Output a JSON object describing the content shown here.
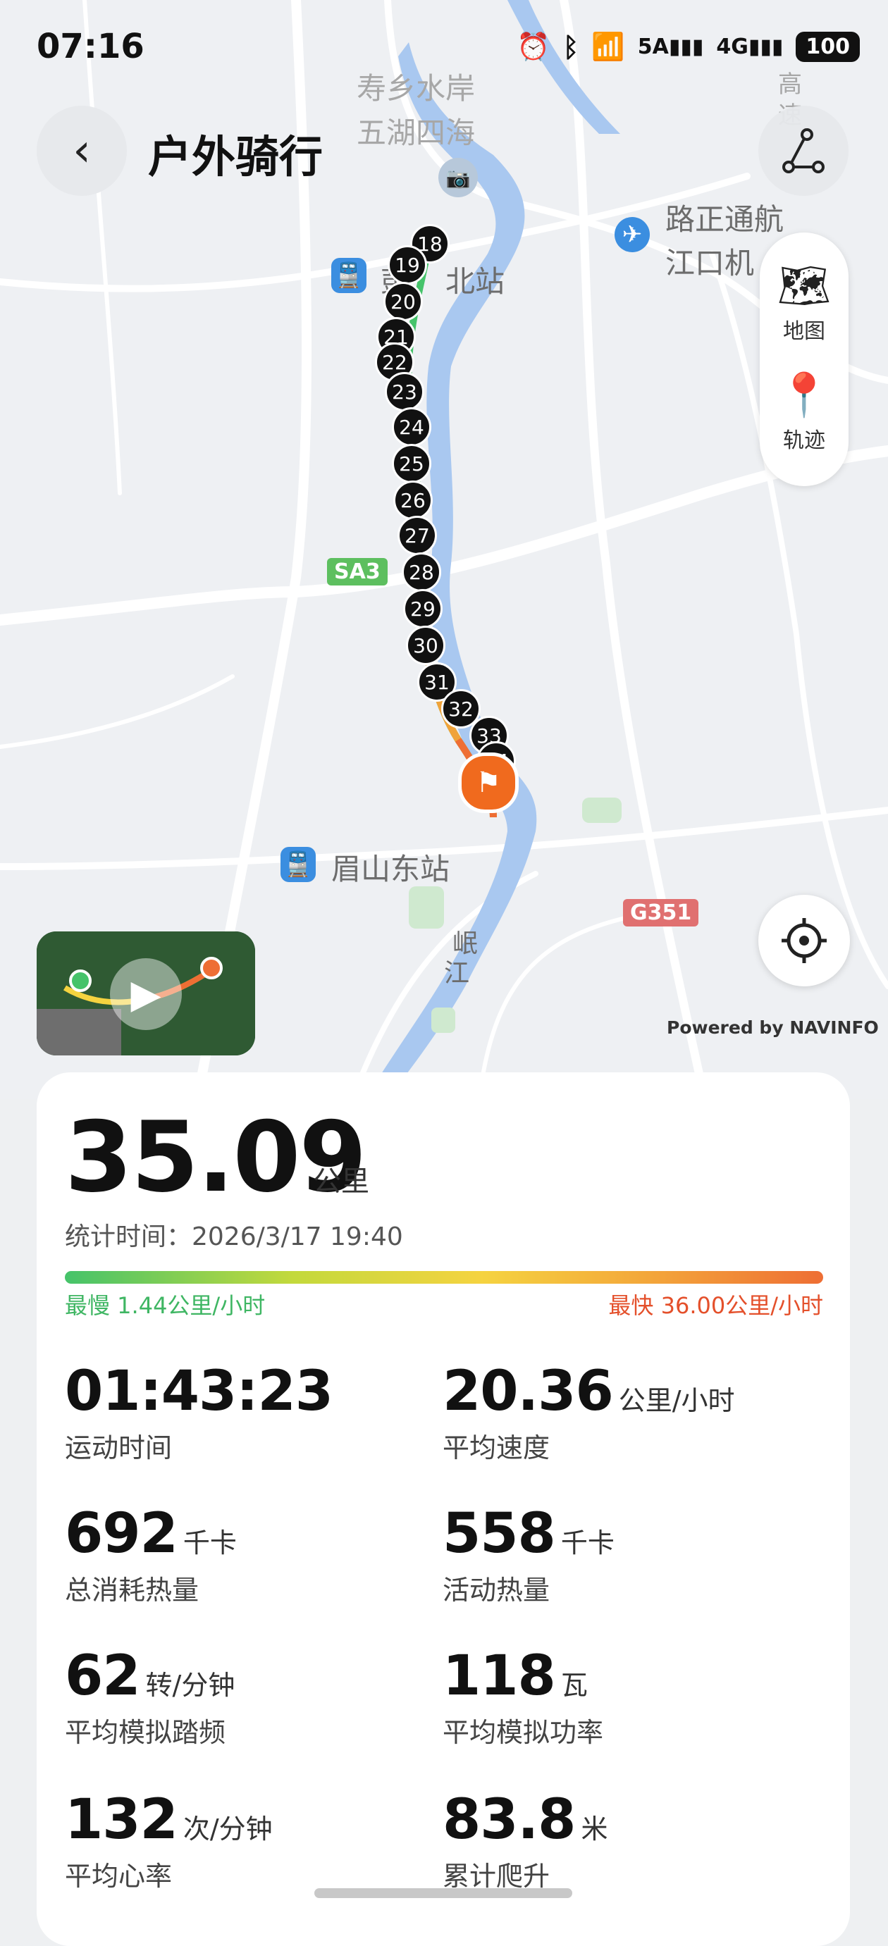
{
  "status_bar": {
    "time": "07:16",
    "icons": [
      "alarm-icon",
      "bluetooth-icon",
      "wifi-icon",
      "signal-5a-icon",
      "signal-4g-icon"
    ],
    "sig1_label": "5A",
    "sig2_label": "4G",
    "battery": "100"
  },
  "header": {
    "title": "户外骑行"
  },
  "map": {
    "labels": {
      "shouxiang": "寿乡水岸",
      "wuhu": "五湖四海",
      "gaosu_1": "高",
      "gaosu_2": "速",
      "luzheng_1": "路正通航",
      "luzheng_2": "江口机",
      "pengshan_station_a": "彭",
      "pengshan_station_b": "北站",
      "meishan_east": "眉山东站",
      "minjiang_1": "岷",
      "minjiang_2": "江"
    },
    "road_badges": {
      "sa3": "SA3",
      "g351": "G351"
    },
    "markers": [
      "18",
      "19",
      "20",
      "21",
      "22",
      "23",
      "24",
      "25",
      "26",
      "27",
      "28",
      "29",
      "30",
      "31",
      "32",
      "33",
      "34"
    ],
    "powered_by": "Powered by NAVINFO"
  },
  "layer_panel": {
    "map_label": "地图",
    "track_label": "轨迹"
  },
  "summary": {
    "distance": "35.09",
    "distance_unit": "公里",
    "stat_time": "统计时间：2026/3/17 19:40",
    "slowest": "最慢 1.44公里/小时",
    "fastest": "最快 36.00公里/小时",
    "metrics": [
      {
        "value": "01:43:23",
        "unit": "",
        "label": "运动时间"
      },
      {
        "value": "20.36",
        "unit": "公里/小时",
        "label": "平均速度"
      },
      {
        "value": "692",
        "unit": "千卡",
        "label": "总消耗热量"
      },
      {
        "value": "558",
        "unit": "千卡",
        "label": "活动热量"
      },
      {
        "value": "62",
        "unit": "转/分钟",
        "label": "平均模拟踏频"
      },
      {
        "value": "118",
        "unit": "瓦",
        "label": "平均模拟功率"
      },
      {
        "value": "132",
        "unit": "次/分钟",
        "label": "平均心率"
      },
      {
        "value": "83.8",
        "unit": "米",
        "label": "累计爬升"
      }
    ]
  },
  "colors": {
    "route_start": "#45c36a",
    "route_end": "#ee6e34",
    "slow_text": "#3fb663",
    "fast_text": "#e4502b",
    "river": "#a9c8f0",
    "marker": "#111111"
  }
}
